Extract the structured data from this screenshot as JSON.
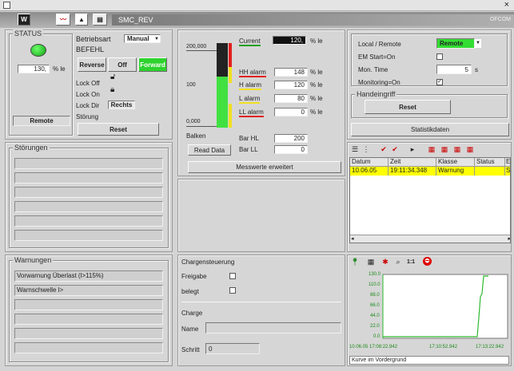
{
  "titlebar": {
    "close": "×"
  },
  "toolbar": {
    "tab_w": "W",
    "tab_up": "▲",
    "tag_name": "SMC_REV",
    "brand": "OFCOM"
  },
  "status": {
    "title": "STATUS",
    "value": "130,",
    "unit": "% le",
    "mode": "Remote",
    "betriebsart_label": "Betriebsart",
    "betriebsart_value": "Manual",
    "befehl_label": "BEFEHL",
    "reverse": "Reverse",
    "off": "Off",
    "forward": "Forward",
    "lock_off": "Lock Off",
    "lock_on": "Lock On",
    "lock_dir": "Lock Dir",
    "lock_dir_value": "Rechts",
    "stoerung": "Störung",
    "reset": "Reset"
  },
  "bar_panel": {
    "scale": [
      "200,000",
      "100",
      "0,000"
    ],
    "current_label": "Current",
    "current_value": "120,",
    "unit": "% le",
    "alarms": [
      {
        "label": "HH alarm",
        "value": "148",
        "unit": "% le"
      },
      {
        "label": "H alarm",
        "value": "120",
        "unit": "% le"
      },
      {
        "label": "L alarm",
        "value": "80",
        "unit": "% le"
      },
      {
        "label": "LL alarm",
        "value": "0",
        "unit": "% le"
      }
    ],
    "balken": "Balken",
    "read_data": "Read Data",
    "bar_hl_label": "Bar HL",
    "bar_hl": "200",
    "bar_ll_label": "Bar LL",
    "bar_ll": "0",
    "messwerte": "Messwerte erweitert",
    "fill_fraction": 0.6
  },
  "right_top": {
    "local_remote_label": "Local / Remote",
    "local_remote_value": "Remote",
    "em_label": "EM Start=On",
    "mon_time_label": "Mon. Time",
    "mon_time_value": "5",
    "mon_time_unit": "s",
    "monitoring_label": "Monitoring=On",
    "handeingriff": "Handeingriff",
    "reset": "Reset",
    "statistik": "Statistikdaten"
  },
  "alarm_table": {
    "headers": [
      "Datum",
      "Zeit",
      "Klasse",
      "Status",
      "E"
    ],
    "rows": [
      [
        "10.06.05",
        "19:11:34.348",
        "Warnung",
        "",
        "S"
      ]
    ]
  },
  "stoerungen": {
    "title": "Störungen"
  },
  "warnungen": {
    "title": "Warnungen",
    "items": [
      "Vorwarnung Überlast (l>115%)",
      "Warnschwelle l>",
      "",
      "",
      "",
      ""
    ]
  },
  "charge": {
    "title": "Chargensteuerung",
    "freigabe": "Freigabe",
    "belegt": "belegt",
    "charge": "Charge",
    "name": "Name",
    "schritt": "Schritt",
    "schritt_value": "0"
  },
  "trend": {
    "y_ticks": [
      "130.0",
      "110.0",
      "88.0",
      "66.0",
      "44.0",
      "22.0",
      "0.0"
    ],
    "x_ticks": [
      "10.06.05  17:08:22.942",
      "17:10:52.942",
      "17:13:22.942"
    ],
    "ratio": "1:1",
    "footer": "Kurve im Vordergrund"
  }
}
